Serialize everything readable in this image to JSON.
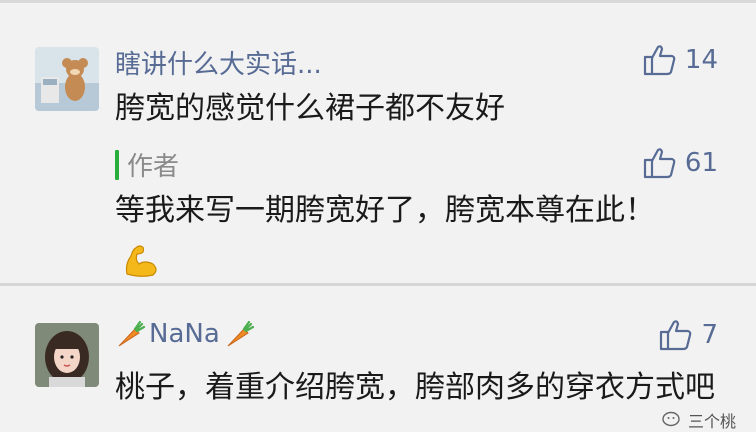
{
  "comments": [
    {
      "username": "瞎讲什么大实话...",
      "like_count": "14",
      "text": "胯宽的感觉什么裙子都不友好",
      "reply": {
        "label": "作者",
        "like_count": "61",
        "text": "等我来写一期胯宽好了，胯宽本尊在此！"
      }
    },
    {
      "username": "NaNa",
      "like_count": "7",
      "text": "桃子，着重介绍胯宽，胯部肉多的穿衣方式吧"
    }
  ],
  "watermark": {
    "text": "三个桃"
  },
  "icons": {
    "like": "thumbs-up-outline-icon",
    "flex": "flexed-biceps-emoji",
    "carrot": "carrot-emoji"
  },
  "colors": {
    "link_blue": "#576b95",
    "author_green": "#2aae3b",
    "background": "#f2f2f2"
  }
}
